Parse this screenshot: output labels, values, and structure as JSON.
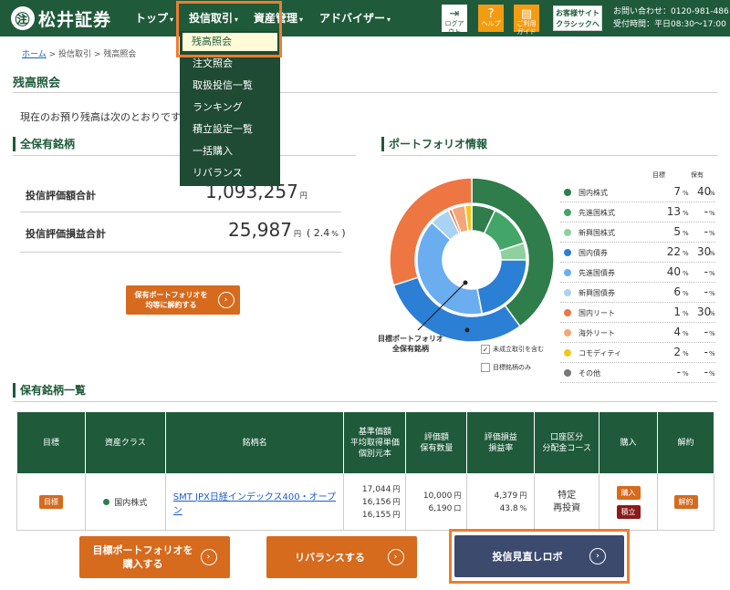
{
  "header": {
    "brand": "松井証券",
    "nav": [
      "トップ",
      "投信取引",
      "資産管理",
      "アドバイザー"
    ],
    "buttons": {
      "logout": "ログアウト",
      "help": "ヘルプ",
      "guide": "ご利用ガイド"
    },
    "classic": "お客様サイトクラシックへ",
    "contact_label": "お問い合わせ：0120-981-486",
    "hours": "受付時間：平日08:30～17:00"
  },
  "dropdown": [
    "残高照会",
    "注文照会",
    "取扱投信一覧",
    "ランキング",
    "積立設定一覧",
    "一括購入",
    "リバランス"
  ],
  "breadcrumb": {
    "home": "ホーム",
    "sep": ">",
    "p1": "投信取引",
    "p2": "残高照会"
  },
  "page_title": "残高照会",
  "intro": "現在のお預り残高は次のとおりです。",
  "holdings_section": "全保有銘柄",
  "summary": {
    "valuation_label": "投信評価額合計",
    "valuation_value": "1,093,257",
    "pl_label": "投信評価損益合計",
    "pl_value": "25,987",
    "pl_pct": "2.4",
    "yen": "円",
    "pct_sign": "%"
  },
  "equalize_button": "保有ポートフォリオを均等に解約する",
  "portfolio": {
    "title": "ポートフォリオ情報",
    "col_target": "目標",
    "col_hold": "保有",
    "chart_label_1": "目標ポートフォリオ",
    "chart_label_2": "全保有銘柄",
    "chk1": "未成立取引を含む",
    "chk2": "目標銘柄のみ",
    "legend": [
      {
        "name": "国内株式",
        "color": "#2e7d4a",
        "target": "7",
        "hold": "40"
      },
      {
        "name": "先進国株式",
        "color": "#43a567",
        "target": "13",
        "hold": "-"
      },
      {
        "name": "新興国株式",
        "color": "#8fd19e",
        "target": "5",
        "hold": "-"
      },
      {
        "name": "国内債券",
        "color": "#2b7fd4",
        "target": "22",
        "hold": "30"
      },
      {
        "name": "先進国債券",
        "color": "#6aaef0",
        "target": "40",
        "hold": "-"
      },
      {
        "name": "新興国債券",
        "color": "#a9d2f5",
        "target": "6",
        "hold": "-"
      },
      {
        "name": "国内リート",
        "color": "#ee7643",
        "target": "1",
        "hold": "30"
      },
      {
        "name": "海外リート",
        "color": "#f3a67a",
        "target": "4",
        "hold": "-"
      },
      {
        "name": "コモディティ",
        "color": "#f5c518",
        "target": "2",
        "hold": "-"
      },
      {
        "name": "その他",
        "color": "#777777",
        "target": "-",
        "hold": "-"
      }
    ]
  },
  "list_section": "保有銘柄一覧",
  "table": {
    "headers": [
      "目標",
      "資産クラス",
      "銘柄名",
      "基準価額\n平均取得単価\n個別元本",
      "評価額\n保有数量",
      "評価損益\n損益率",
      "口座区分\n分配金コース",
      "購入",
      "解約"
    ],
    "row": {
      "target_tag": "目標",
      "asset_class": "国内株式",
      "fund": "SMT JPX日経インデックス400・オープン",
      "nav": "17,044",
      "avg": "16,156",
      "principal": "16,155",
      "valuation": "10,000",
      "qty": "6,190",
      "pl": "4,379",
      "pl_rate": "43.8",
      "account": "特定",
      "course": "再投資",
      "buy": "購入",
      "accum": "積立",
      "sell": "解約",
      "unit_yen": "円",
      "unit_qty": "口",
      "unit_pct": "%"
    }
  },
  "bottom_buttons": {
    "buy_target": "目標ポートフォリオを購入する",
    "rebalance": "リバランスする",
    "robot": "投信見直しロボ"
  },
  "chart_data": {
    "type": "pie",
    "series": [
      {
        "name": "目標ポートフォリオ",
        "categories": [
          "国内株式",
          "先進国株式",
          "新興国株式",
          "国内債券",
          "先進国債券",
          "新興国債券",
          "国内リート",
          "海外リート",
          "コモディティ",
          "その他"
        ],
        "values": [
          7,
          13,
          5,
          22,
          40,
          6,
          1,
          4,
          2,
          0
        ]
      },
      {
        "name": "全保有銘柄",
        "categories": [
          "国内株式",
          "国内債券",
          "国内リート"
        ],
        "values": [
          40,
          30,
          30
        ]
      }
    ]
  }
}
